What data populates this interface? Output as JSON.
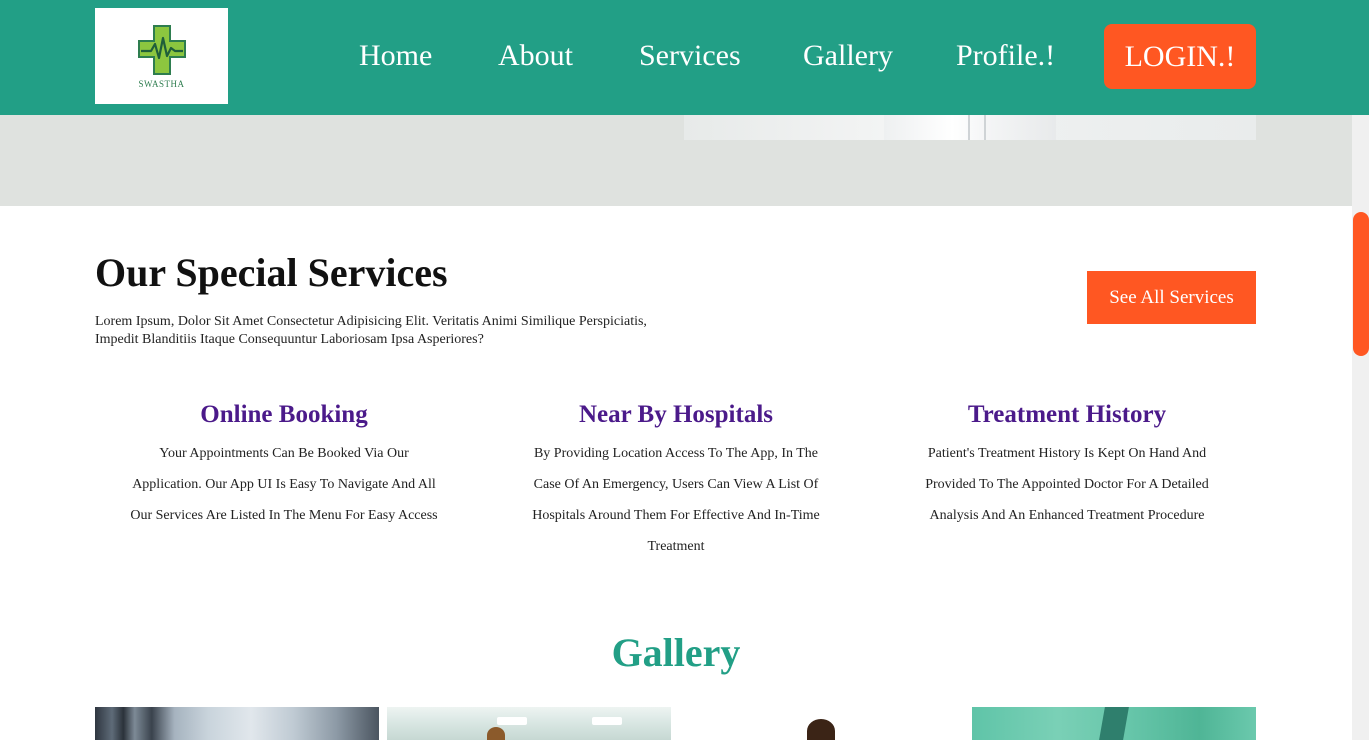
{
  "header": {
    "logo_text": "SWASTHA",
    "nav": [
      {
        "label": "Home"
      },
      {
        "label": "About"
      },
      {
        "label": "Services"
      },
      {
        "label": "Gallery"
      },
      {
        "label": "Profile.!"
      }
    ],
    "login_label": "LOGIN.!"
  },
  "services": {
    "title": "Our Special Services",
    "description": "Lorem Ipsum, Dolor Sit Amet Consectetur Adipisicing Elit. Veritatis Animi Similique Perspiciatis, Impedit Blanditiis Itaque Consequuntur Laboriosam Ipsa Asperiores?",
    "see_all_label": "See All Services",
    "cards": [
      {
        "title": "Online Booking",
        "text": "Your Appointments Can Be Booked Via Our Application. Our App UI Is Easy To Navigate And All Our Services Are Listed In The Menu For Easy Access"
      },
      {
        "title": "Near By Hospitals",
        "text": "By Providing Location Access To The App, In The Case Of An Emergency, Users Can View A List Of Hospitals Around Them For Effective And In-Time Treatment"
      },
      {
        "title": "Treatment History",
        "text": "Patient's Treatment History Is Kept On Hand And Provided To The Appointed Doctor For A Detailed Analysis And An Enhanced Treatment Procedure"
      }
    ]
  },
  "gallery": {
    "title": "Gallery"
  },
  "colors": {
    "brand": "#229f86",
    "accent": "#ff5722",
    "card_title": "#4b1a8a"
  }
}
